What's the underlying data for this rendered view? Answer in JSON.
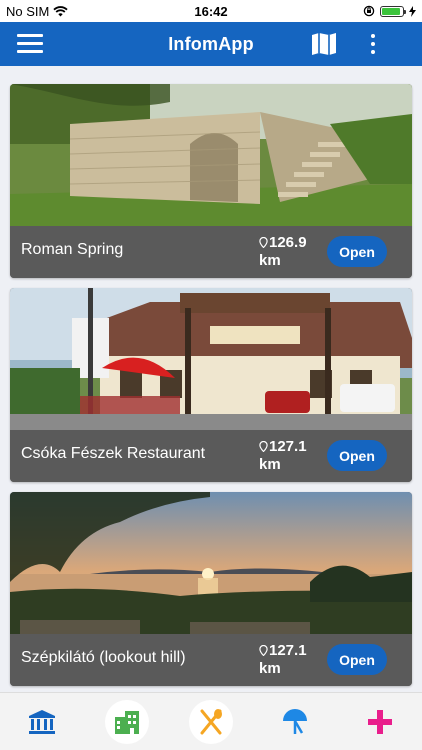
{
  "status_bar": {
    "carrier": "No SIM",
    "time": "16:42",
    "battery_level": 0.9
  },
  "nav": {
    "title": "InfomApp",
    "menu_icon": "hamburger-menu-icon",
    "map_icon": "map-icon",
    "more_icon": "more-vertical-icon"
  },
  "places": [
    {
      "title": "Roman Spring",
      "distance_value": "126.9",
      "distance_unit": "km",
      "button": "Open",
      "image": "stone-wall-with-stairs"
    },
    {
      "title": "Csóka Fészek Restaurant",
      "distance_value": "127.1",
      "distance_unit": "km",
      "button": "Open",
      "image": "restaurant-building"
    },
    {
      "title": "Szépkilátó (lookout hill)",
      "distance_value": "127.1",
      "distance_unit": "km",
      "button": "Open",
      "image": "sunset-over-lake"
    }
  ],
  "tabs": [
    {
      "icon": "museum-icon",
      "color": "#1565c0"
    },
    {
      "icon": "buildings-icon",
      "color": "#4caf50"
    },
    {
      "icon": "restaurant-icon",
      "color": "#f5a623"
    },
    {
      "icon": "beach-umbrella-icon",
      "color": "#1e88e5"
    },
    {
      "icon": "plus-icon",
      "color": "#e91e8c"
    }
  ],
  "colors": {
    "primary": "#1565c0",
    "card_footer": "#5a5a5a"
  }
}
